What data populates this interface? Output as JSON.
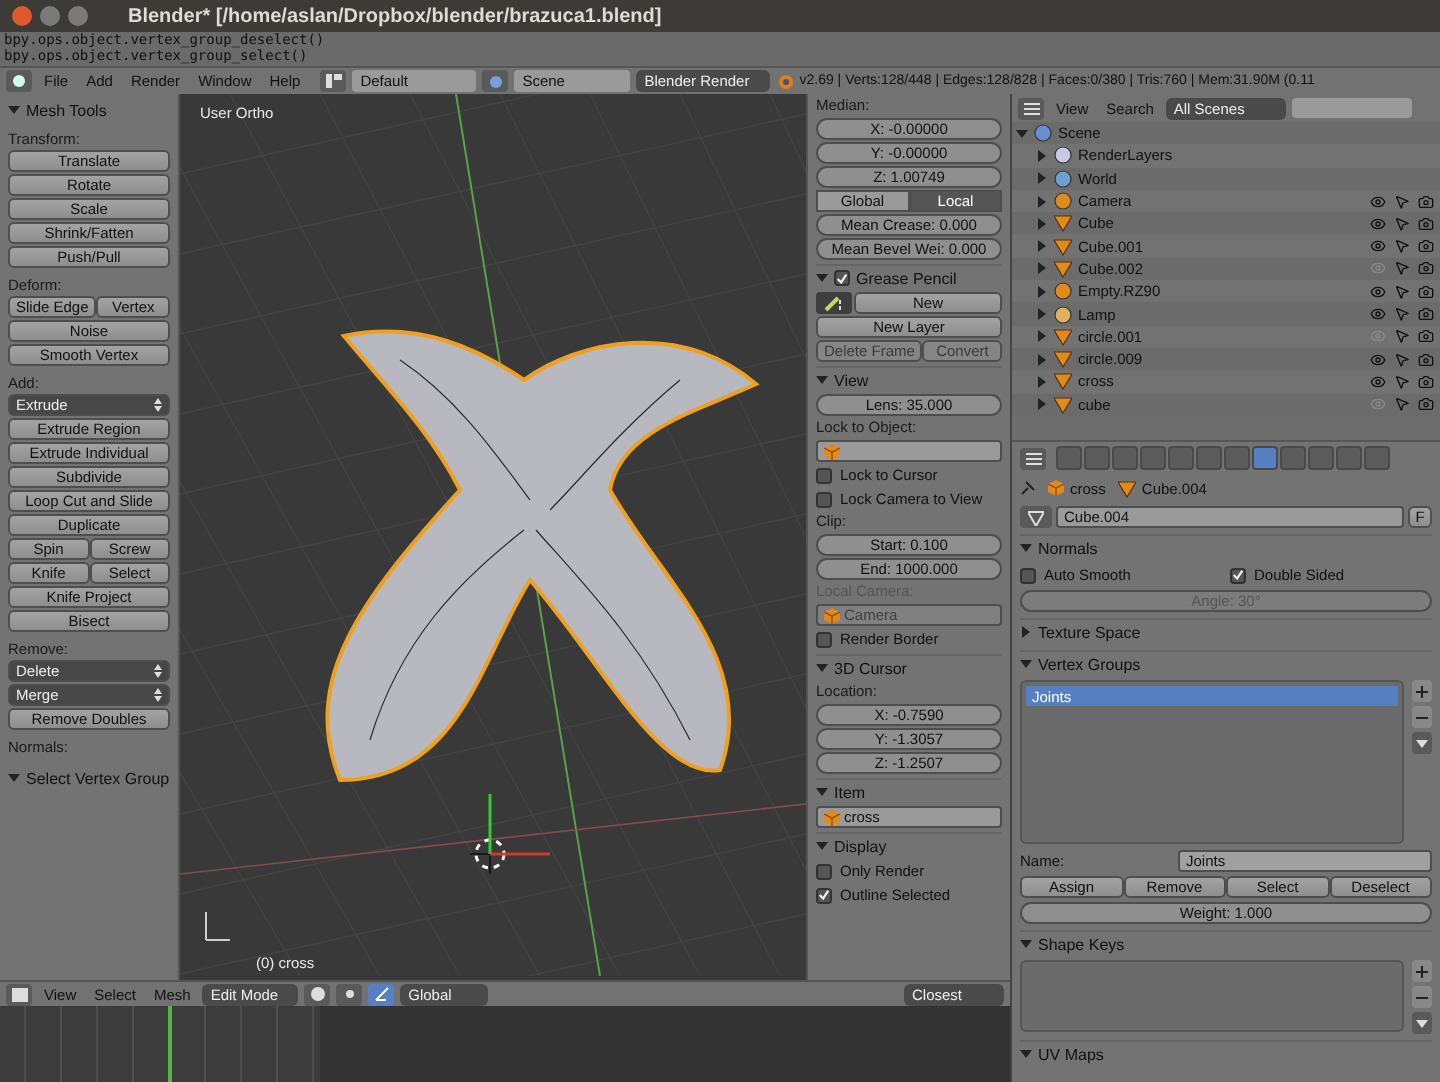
{
  "window": {
    "title": "Blender* [/home/aslan/Dropbox/blender/brazuca1.blend]"
  },
  "console": {
    "lines": [
      "bpy.ops.object.vertex_group_deselect()",
      "bpy.ops.object.vertex_group_select()"
    ]
  },
  "info_header": {
    "menus": [
      "File",
      "Add",
      "Render",
      "Window",
      "Help"
    ],
    "layout": "Default",
    "scene": "Scene",
    "engine": "Blender Render",
    "stats": "v2.69 | Verts:128/448 | Edges:128/828 | Faces:0/380 | Tris:760 | Mem:31.90M (0.11"
  },
  "tool_shelf": {
    "title": "Mesh Tools",
    "expanded": true,
    "groups": [
      {
        "label": "Transform:",
        "rows": [
          [
            {
              "label": "Translate",
              "kind": "button"
            }
          ],
          [
            {
              "label": "Rotate",
              "kind": "button"
            }
          ],
          [
            {
              "label": "Scale",
              "kind": "button"
            }
          ],
          [
            {
              "label": "Shrink/Fatten",
              "kind": "button"
            }
          ],
          [
            {
              "label": "Push/Pull",
              "kind": "button"
            }
          ]
        ]
      },
      {
        "label": "Deform:",
        "rows": [
          [
            {
              "label": "Slide Edge",
              "kind": "button"
            },
            {
              "label": "Vertex",
              "kind": "button"
            }
          ],
          [
            {
              "label": "Noise",
              "kind": "button"
            }
          ],
          [
            {
              "label": "Smooth Vertex",
              "kind": "button"
            }
          ]
        ]
      },
      {
        "label": "Add:",
        "rows": [
          [
            {
              "label": "Extrude",
              "kind": "dropdown"
            }
          ],
          [
            {
              "label": "Extrude Region",
              "kind": "button"
            }
          ],
          [
            {
              "label": "Extrude Individual",
              "kind": "button"
            }
          ],
          [
            {
              "label": "Subdivide",
              "kind": "button"
            }
          ],
          [
            {
              "label": "Loop Cut and Slide",
              "kind": "button"
            }
          ],
          [
            {
              "label": "Duplicate",
              "kind": "button"
            }
          ],
          [
            {
              "label": "Spin",
              "kind": "button"
            },
            {
              "label": "Screw",
              "kind": "button"
            }
          ],
          [
            {
              "label": "Knife",
              "kind": "button"
            },
            {
              "label": "Select",
              "kind": "button"
            }
          ],
          [
            {
              "label": "Knife Project",
              "kind": "button"
            }
          ],
          [
            {
              "label": "Bisect",
              "kind": "button"
            }
          ]
        ]
      },
      {
        "label": "Remove:",
        "rows": [
          [
            {
              "label": "Delete",
              "kind": "dropdown"
            }
          ],
          [
            {
              "label": "Merge",
              "kind": "dropdown"
            }
          ],
          [
            {
              "label": "Remove Doubles",
              "kind": "button"
            }
          ]
        ]
      },
      {
        "label": "Normals:"
      }
    ],
    "footer": {
      "label": "Select Vertex Group",
      "expanded": true
    }
  },
  "viewport": {
    "view_label": "User Ortho",
    "object_label": "(0) cross"
  },
  "viewport_header": {
    "menus": [
      "View",
      "Select",
      "Mesh"
    ],
    "mode": "Edit Mode",
    "orientation": "Global",
    "snap": "Closest"
  },
  "view_properties": [
    {
      "kind": "label",
      "text": "Median:",
      "disabled": false
    },
    {
      "kind": "number",
      "text": "X: -0.00000",
      "disabled": false
    },
    {
      "kind": "number",
      "text": "Y: -0.00000",
      "disabled": false
    },
    {
      "kind": "number",
      "text": "Z: 1.00749",
      "disabled": false
    },
    {
      "kind": "toggle",
      "options": [
        {
          "label": "Global",
          "selected": false
        },
        {
          "label": "Local",
          "selected": true
        }
      ]
    },
    {
      "kind": "number",
      "text": "Mean Crease: 0.000",
      "disabled": false
    },
    {
      "kind": "number",
      "text": "Mean Bevel Wei: 0.000",
      "disabled": false
    },
    {
      "kind": "check-header",
      "text": "Grease Pencil",
      "expanded": true,
      "checked": true
    },
    {
      "kind": "new-row",
      "text": "New"
    },
    {
      "kind": "buttons",
      "buttons": [
        {
          "label": "New Layer",
          "disabled": false
        }
      ]
    },
    {
      "kind": "buttons",
      "buttons": [
        {
          "label": "Delete Frame",
          "disabled": true
        },
        {
          "label": "Convert",
          "disabled": true
        }
      ]
    },
    {
      "kind": "header",
      "text": "View",
      "expanded": true
    },
    {
      "kind": "number",
      "text": "Lens: 35.000",
      "disabled": false
    },
    {
      "kind": "label",
      "text": "Lock to Object:",
      "disabled": false
    },
    {
      "kind": "object-field",
      "disabled": false
    },
    {
      "kind": "checkbox",
      "text": "Lock to Cursor",
      "checked": false
    },
    {
      "kind": "checkbox",
      "text": "Lock Camera to View",
      "checked": false
    },
    {
      "kind": "label",
      "text": "Clip:",
      "disabled": false
    },
    {
      "kind": "number",
      "text": "Start: 0.100",
      "disabled": false
    },
    {
      "kind": "number",
      "text": "End: 1000.000",
      "disabled": false
    },
    {
      "kind": "label",
      "text": "Local Camera:",
      "disabled": true
    },
    {
      "kind": "object-field",
      "value": "Camera",
      "disabled": true
    },
    {
      "kind": "checkbox",
      "text": "Render Border",
      "checked": false
    },
    {
      "kind": "header",
      "text": "3D Cursor",
      "expanded": true
    },
    {
      "kind": "label",
      "text": "Location:",
      "disabled": false
    },
    {
      "kind": "number",
      "text": "X: -0.7590",
      "disabled": false
    },
    {
      "kind": "number",
      "text": "Y: -1.3057",
      "disabled": false
    },
    {
      "kind": "number",
      "text": "Z: -1.2507",
      "disabled": false
    },
    {
      "kind": "header",
      "text": "Item",
      "expanded": true
    },
    {
      "kind": "object-field",
      "value": "cross",
      "disabled": false
    },
    {
      "kind": "header",
      "text": "Display",
      "expanded": true
    },
    {
      "kind": "checkbox",
      "text": "Only Render",
      "checked": false
    },
    {
      "kind": "checkbox",
      "text": "Outline Selected",
      "checked": true
    }
  ],
  "outliner": {
    "menus": [
      "View",
      "Search"
    ],
    "filter": "All Scenes",
    "tree": [
      {
        "label": "Scene",
        "kind": "scene",
        "expanded": true,
        "children": [
          {
            "label": "RenderLayers",
            "kind": "renderlayers"
          },
          {
            "label": "World",
            "kind": "world"
          },
          {
            "label": "Camera",
            "kind": "camera",
            "visible": true
          },
          {
            "label": "Cube",
            "kind": "mesh",
            "visible": true
          },
          {
            "label": "Cube.001",
            "kind": "mesh",
            "visible": true
          },
          {
            "label": "Cube.002",
            "kind": "mesh",
            "visible": false
          },
          {
            "label": "Empty.RZ90",
            "kind": "empty",
            "visible": true
          },
          {
            "label": "Lamp",
            "kind": "lamp",
            "visible": true
          },
          {
            "label": "circle.001",
            "kind": "mesh",
            "visible": false
          },
          {
            "label": "circle.009",
            "kind": "mesh",
            "visible": true
          },
          {
            "label": "cross",
            "kind": "mesh",
            "visible": true
          },
          {
            "label": "cube",
            "kind": "mesh",
            "visible": false
          }
        ]
      }
    ]
  },
  "properties": {
    "tabs": [
      {
        "selected": false
      },
      {
        "selected": false
      },
      {
        "selected": false
      },
      {
        "selected": false
      },
      {
        "selected": false
      },
      {
        "selected": false
      },
      {
        "selected": false
      },
      {
        "selected": true
      },
      {
        "selected": false
      },
      {
        "selected": false
      },
      {
        "selected": false
      },
      {
        "selected": false
      }
    ],
    "breadcrumb": [
      "cross",
      "Cube.004"
    ],
    "datablock": "Cube.004",
    "fake_user": "F",
    "items": [
      {
        "kind": "header",
        "text": "Normals",
        "expanded": true
      },
      {
        "kind": "checkbox-row",
        "boxes": [
          {
            "text": "Auto Smooth",
            "checked": false
          },
          {
            "text": "Double Sided",
            "checked": true
          }
        ]
      },
      {
        "kind": "number",
        "text": "Angle: 30°",
        "disabled": true
      },
      {
        "kind": "header",
        "text": "Texture Space",
        "expanded": false
      },
      {
        "kind": "header",
        "text": "Vertex Groups",
        "expanded": true
      },
      {
        "kind": "list",
        "rows": [
          {
            "label": "Joints",
            "selected": true
          }
        ]
      },
      {
        "kind": "name-field",
        "text": "Name:",
        "value": "Joints"
      },
      {
        "kind": "buttons",
        "buttons": [
          {
            "label": "Assign",
            "disabled": false
          },
          {
            "label": "Remove",
            "disabled": false
          },
          {
            "label": "Select",
            "disabled": false
          },
          {
            "label": "Deselect",
            "disabled": false
          }
        ]
      },
      {
        "kind": "number",
        "text": "Weight: 1.000",
        "disabled": false
      },
      {
        "kind": "header",
        "text": "Shape Keys",
        "expanded": true
      },
      {
        "kind": "list"
      },
      {
        "kind": "header",
        "text": "UV Maps",
        "expanded": true
      }
    ]
  }
}
